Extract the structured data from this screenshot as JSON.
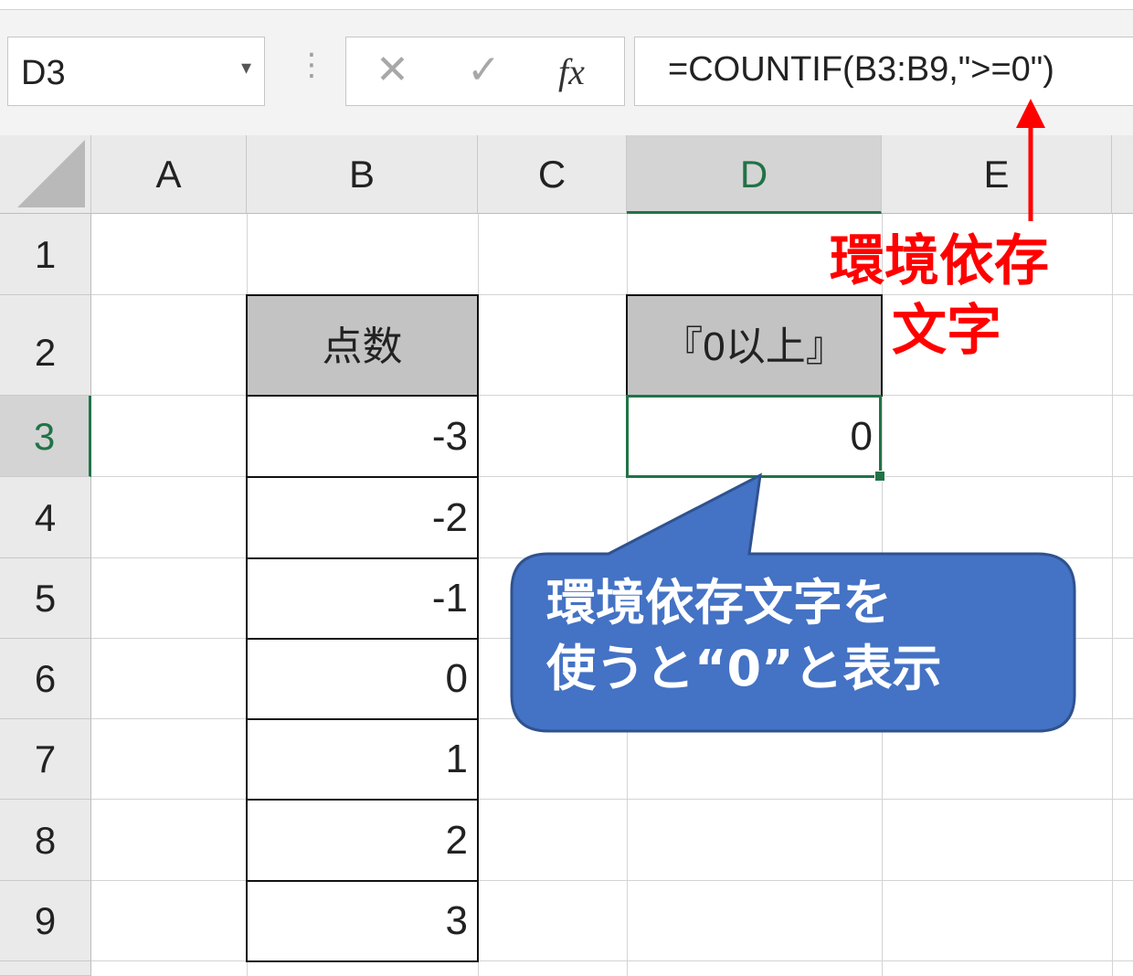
{
  "formula_bar": {
    "name_box": "D3",
    "cancel_icon": "✕",
    "enter_icon": "✓",
    "fx_label": "fx",
    "formula": "=COUNTIF(B3:B9,\">=0\")"
  },
  "columns": [
    "A",
    "B",
    "C",
    "D",
    "E"
  ],
  "rows": [
    "1",
    "2",
    "3",
    "4",
    "5",
    "6",
    "7",
    "8",
    "9"
  ],
  "cells": {
    "B2": "点数",
    "B3": "-3",
    "B4": "-2",
    "B5": "-1",
    "B6": "0",
    "B7": "1",
    "B8": "2",
    "B9": "3",
    "D2": "『0以上』",
    "D3": "0"
  },
  "annotations": {
    "red_label_line1": "環境依存",
    "red_label_line2": "文字",
    "callout_line1": "環境依存文字を",
    "callout_line2": "使うと“0”と表示"
  },
  "colors": {
    "selection": "#217346",
    "annotation_red": "#ff0000",
    "callout_fill": "#4472c4",
    "callout_border": "#2f528f"
  }
}
